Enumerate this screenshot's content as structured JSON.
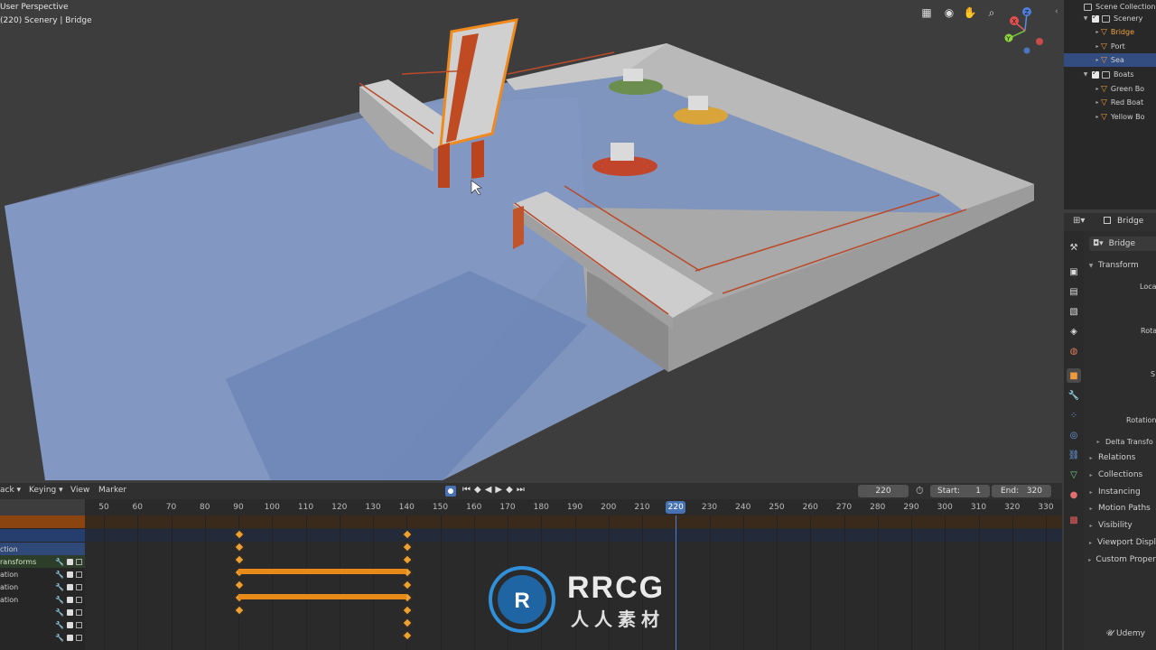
{
  "viewport": {
    "title": "User Perspective",
    "subtitle": "(220) Scenery | Bridge",
    "axes": {
      "x": "X",
      "y": "Y",
      "z": "Z"
    },
    "nav_icons": [
      "grid-icon",
      "camera-icon",
      "hand-icon",
      "zoom-icon"
    ]
  },
  "outliner": {
    "root": "Scene Collection",
    "rows": [
      {
        "label": "Scenery",
        "kind": "collection"
      },
      {
        "label": "Bridge",
        "kind": "object",
        "active": true
      },
      {
        "label": "Port",
        "kind": "object"
      },
      {
        "label": "Sea",
        "kind": "object",
        "selected": true
      },
      {
        "label": "Boats",
        "kind": "collection"
      },
      {
        "label": "Green Bo",
        "kind": "object"
      },
      {
        "label": "Red Boat",
        "kind": "object"
      },
      {
        "label": "Yellow Bo",
        "kind": "object"
      }
    ]
  },
  "properties": {
    "header_object": "Bridge",
    "object_name": "Bridge",
    "transform_title": "Transform",
    "field_labels": [
      "Loca",
      "Rota",
      "S",
      "Rotation"
    ],
    "delta": "Delta Transfo",
    "sections": [
      "Relations",
      "Collections",
      "Instancing",
      "Motion Paths",
      "Visibility",
      "Viewport Displ",
      "Custom Proper"
    ]
  },
  "timeline": {
    "menus": [
      "ack",
      "Keying",
      "View",
      "Marker"
    ],
    "current_frame": "220",
    "start_label": "Start:",
    "start": "1",
    "end_label": "End:",
    "end": "320",
    "ruler": [
      "50",
      "60",
      "70",
      "80",
      "90",
      "100",
      "110",
      "120",
      "130",
      "140",
      "150",
      "160",
      "170",
      "180",
      "190",
      "200",
      "210",
      "220",
      "230",
      "240",
      "250",
      "260",
      "270",
      "280",
      "290",
      "300",
      "310",
      "320",
      "330"
    ],
    "channels": [
      "",
      "",
      "ction",
      "ransforms",
      "ation",
      "ation",
      "ation",
      "",
      "",
      "",
      ""
    ],
    "keyframes": [
      90,
      140
    ]
  },
  "watermark": {
    "brand": "RRCG",
    "sub": "人人素材",
    "credit": "Udemy"
  }
}
